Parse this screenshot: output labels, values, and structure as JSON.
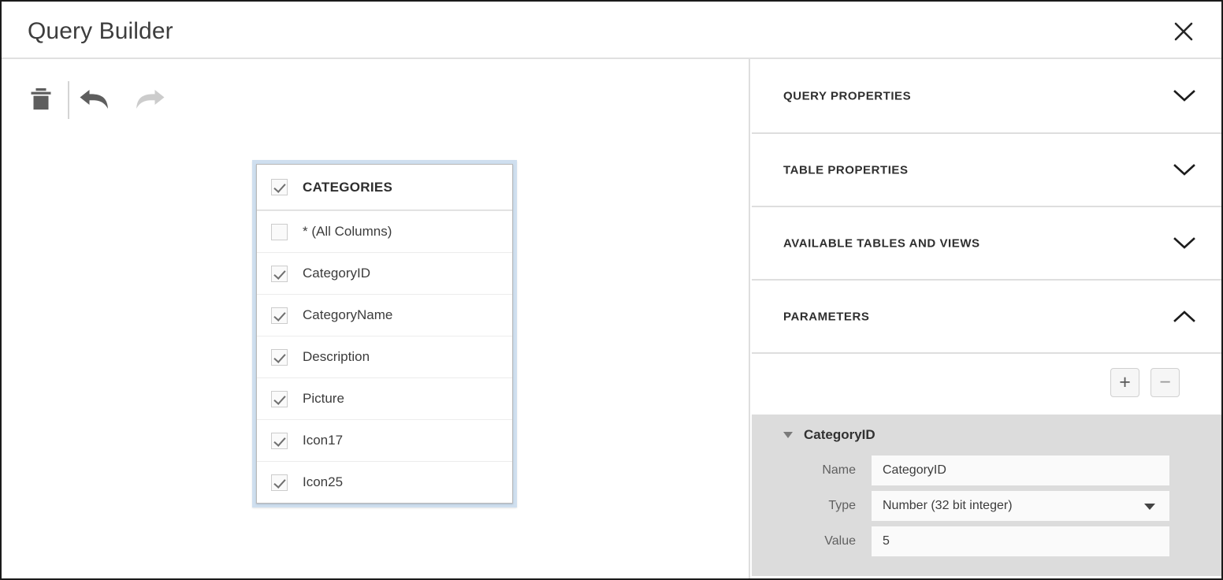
{
  "window": {
    "title": "Query Builder",
    "close_label": "×"
  },
  "toolbar": {
    "delete_label": "Delete",
    "undo_label": "Undo",
    "redo_label": "Redo"
  },
  "canvas": {
    "table_card": {
      "name": "CATEGORIES",
      "checked": true,
      "columns": [
        {
          "label": "* (All Columns)",
          "checked": false
        },
        {
          "label": "CategoryID",
          "checked": true
        },
        {
          "label": "CategoryName",
          "checked": true
        },
        {
          "label": "Description",
          "checked": true
        },
        {
          "label": "Picture",
          "checked": true
        },
        {
          "label": "Icon17",
          "checked": true
        },
        {
          "label": "Icon25",
          "checked": true
        }
      ]
    }
  },
  "panel": {
    "sections": [
      {
        "title": "QUERY PROPERTIES",
        "expanded": false
      },
      {
        "title": "TABLE PROPERTIES",
        "expanded": false
      },
      {
        "title": "AVAILABLE TABLES AND VIEWS",
        "expanded": false
      },
      {
        "title": "PARAMETERS",
        "expanded": true
      }
    ],
    "parameters": {
      "add_label": "+",
      "remove_label": "−",
      "group": {
        "name": "CategoryID",
        "fields": {
          "name_label": "Name",
          "name_value": "CategoryID",
          "type_label": "Type",
          "type_value": "Number (32 bit integer)",
          "value_label": "Value",
          "value_value": "5"
        }
      }
    }
  },
  "colors": {
    "selection_ring": "#cfdfef",
    "panel_gray": "#dcdcdc",
    "text_dark": "#3c3c3c",
    "divider": "#dedede"
  }
}
